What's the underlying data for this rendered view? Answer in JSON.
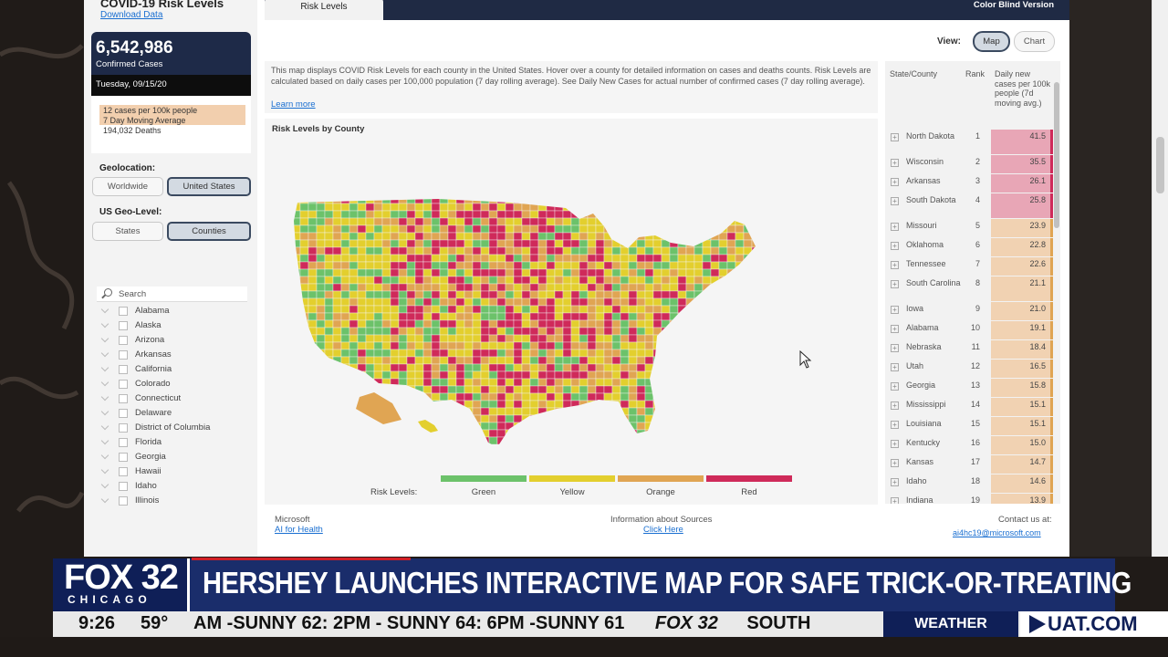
{
  "dashboard": {
    "title": "COVID-19 Risk Levels",
    "download_label": "Download Data",
    "confirmed_number": "6,542,986",
    "confirmed_label": "Confirmed Cases",
    "date": "Tuesday, 09/15/20",
    "stat_line1": "12 cases per 100k people",
    "stat_line2": "7 Day Moving Average",
    "stat_line3": "194,032 Deaths",
    "geolocation_label": "Geolocation:",
    "geo_worldwide": "Worldwide",
    "geo_us": "United States",
    "geolevel_label": "US Geo-Level:",
    "level_states": "States",
    "level_counties": "Counties",
    "search_placeholder": "Search",
    "states": [
      "Alabama",
      "Alaska",
      "Arizona",
      "Arkansas",
      "California",
      "Colorado",
      "Connecticut",
      "Delaware",
      "District of Columbia",
      "Florida",
      "Georgia",
      "Hawaii",
      "Idaho",
      "Illinois"
    ]
  },
  "tabs": {
    "active": "Risk Levels",
    "color_blind": "Color Blind Version"
  },
  "view": {
    "label": "View:",
    "map": "Map",
    "chart": "Chart"
  },
  "info": {
    "text": "This map displays COVID Risk Levels for each county in the United States. Hover over a county for detailed information on cases and deaths counts. Risk Levels are calculated based on daily cases per 100,000 population (7 day rolling average). See Daily New Cases for actual number of confirmed cases (7 day rolling average).",
    "learn_more": "Learn more"
  },
  "map": {
    "title": "Risk Levels by County",
    "legend_label": "Risk Levels:",
    "legend": [
      {
        "name": "Green",
        "color": "#6cc26a"
      },
      {
        "name": "Yellow",
        "color": "#e3cf2e"
      },
      {
        "name": "Orange",
        "color": "#e0a553"
      },
      {
        "name": "Red",
        "color": "#cf2a5a"
      }
    ]
  },
  "table": {
    "col_state": "State/County",
    "col_rank": "Rank",
    "col_value": "Daily new cases per 100k people (7d moving avg.)",
    "rows": [
      {
        "state": "North Dakota",
        "rank": "1",
        "value": "41.5",
        "level": "red"
      },
      {
        "state": "Wisconsin",
        "rank": "2",
        "value": "35.5",
        "level": "red"
      },
      {
        "state": "Arkansas",
        "rank": "3",
        "value": "26.1",
        "level": "red"
      },
      {
        "state": "South Dakota",
        "rank": "4",
        "value": "25.8",
        "level": "red"
      },
      {
        "state": "Missouri",
        "rank": "5",
        "value": "23.9",
        "level": "orange"
      },
      {
        "state": "Oklahoma",
        "rank": "6",
        "value": "22.8",
        "level": "orange"
      },
      {
        "state": "Tennessee",
        "rank": "7",
        "value": "22.6",
        "level": "orange"
      },
      {
        "state": "South Carolina",
        "rank": "8",
        "value": "21.1",
        "level": "orange"
      },
      {
        "state": "Iowa",
        "rank": "9",
        "value": "21.0",
        "level": "orange"
      },
      {
        "state": "Alabama",
        "rank": "10",
        "value": "19.1",
        "level": "orange"
      },
      {
        "state": "Nebraska",
        "rank": "11",
        "value": "18.4",
        "level": "orange"
      },
      {
        "state": "Utah",
        "rank": "12",
        "value": "16.5",
        "level": "orange"
      },
      {
        "state": "Georgia",
        "rank": "13",
        "value": "15.8",
        "level": "orange"
      },
      {
        "state": "Mississippi",
        "rank": "14",
        "value": "15.1",
        "level": "orange"
      },
      {
        "state": "Louisiana",
        "rank": "15",
        "value": "15.1",
        "level": "orange"
      },
      {
        "state": "Kentucky",
        "rank": "16",
        "value": "15.0",
        "level": "orange"
      },
      {
        "state": "Kansas",
        "rank": "17",
        "value": "14.7",
        "level": "orange"
      },
      {
        "state": "Idaho",
        "rank": "18",
        "value": "14.6",
        "level": "orange"
      },
      {
        "state": "Indiana",
        "rank": "19",
        "value": "13.9",
        "level": "orange"
      }
    ]
  },
  "footer": {
    "ms": "Microsoft",
    "ms_link": "AI for Health",
    "sources": "Information about Sources",
    "sources_link": "Click Here",
    "contact": "Contact us at:",
    "contact_email": "ai4hc19@microsoft.com"
  },
  "broadcast": {
    "logo_main": "FOX 32",
    "logo_sub": "CHICAGO",
    "headline": "HERSHEY LAUNCHES INTERACTIVE MAP FOR SAFE TRICK-OR-TREATING",
    "time": "9:26",
    "temp": "59°",
    "ticker": "AM -SUNNY 62: 2PM - SUNNY 64: 6PM -SUNNY 61",
    "ticker_brand": "FOX 32",
    "ticker_next": "SOUTH",
    "weather": "WEATHER",
    "uat": "UAT.COM"
  }
}
